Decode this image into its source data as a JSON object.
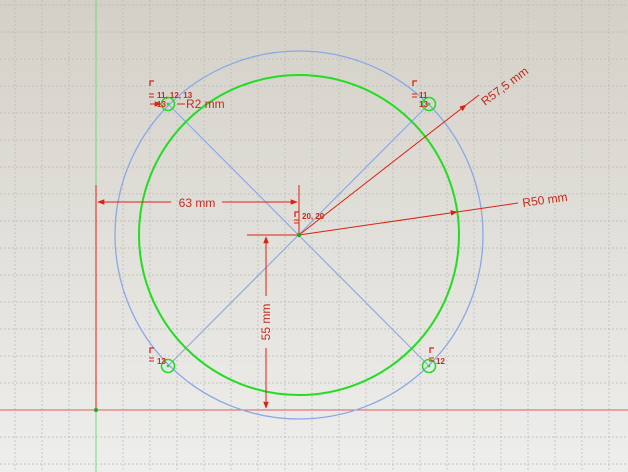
{
  "colors": {
    "constraint": "#dd2211",
    "construction": "#8aa8e8",
    "geometry": "#22dd22",
    "grid": "#b8b8b4",
    "axis_h": "#d86060",
    "axis_v": "#78d878"
  },
  "dimensions": {
    "horizontal": "63 mm",
    "vertical": "55 mm",
    "outer_radius": "R57,5 mm",
    "inner_radius": "R50 mm",
    "hole_radius": "R2 mm"
  },
  "constraint_labels": {
    "top_left_a": "11, 12, 13",
    "top_left_b": "13",
    "top_right_a": "11",
    "top_right_b": "13",
    "center": "20, 20",
    "bottom_left": "13",
    "bottom_right": "12"
  }
}
